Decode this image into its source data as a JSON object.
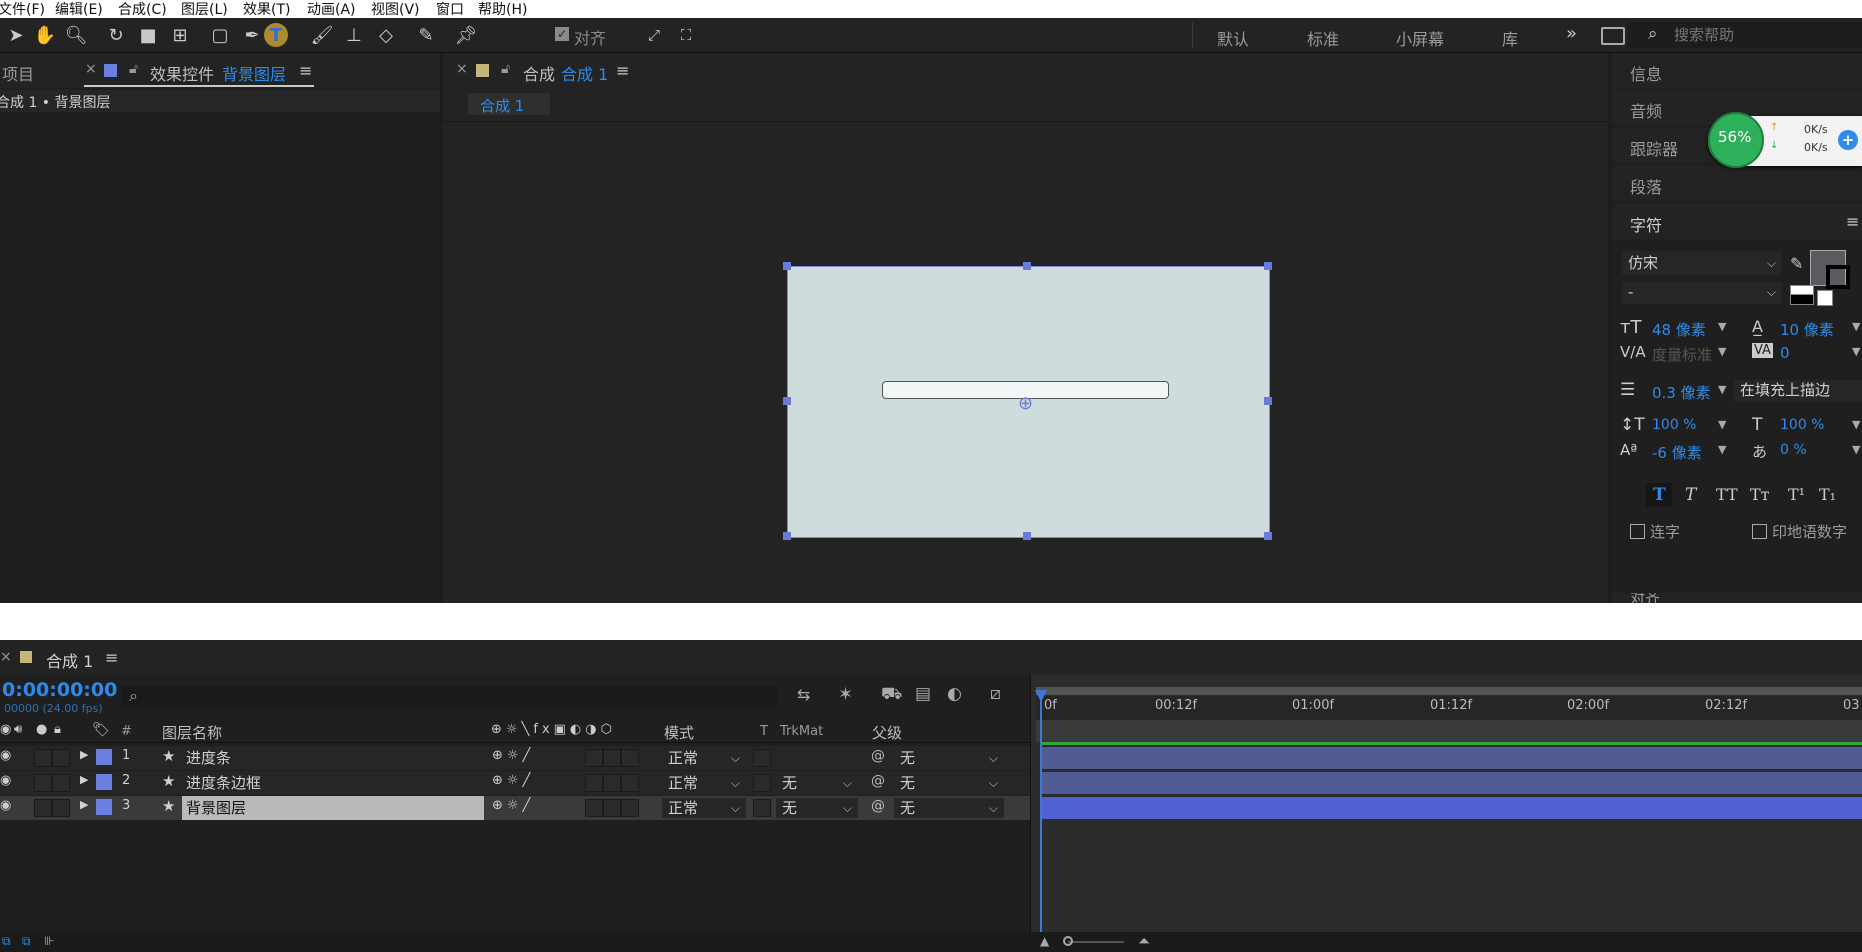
{
  "menu": [
    "文件(F)",
    "编辑(E)",
    "合成(C)",
    "图层(L)",
    "效果(T)",
    "动画(A)",
    "视图(V)",
    "窗口",
    "帮助(H)"
  ],
  "toolbar": {
    "align_label": "对齐",
    "workspaces": [
      "默认",
      "标准",
      "小屏幕",
      "库"
    ],
    "more": "»",
    "search_placeholder": "搜索帮助"
  },
  "left_panel": {
    "project_tab": "项目",
    "close": "×",
    "effects_tab_prefix": "效果控件",
    "effects_tab_layer": "背景图层",
    "menu": "≡",
    "breadcrumb": "合成 1 • 背景图层"
  },
  "comp_panel": {
    "close": "×",
    "tab_prefix": "合成",
    "tab_name": "合成 1",
    "menu": "≡",
    "subtab": "合成 1",
    "canvas_bg": "#cfdcdd"
  },
  "right_panel": {
    "info": "信息",
    "audio": "音频",
    "tracker": "跟踪器",
    "paragraph": "段落",
    "character": "字符",
    "menu": "≡",
    "font": "仿宋",
    "style": "-",
    "size": "48 像素",
    "leading": "10 像素",
    "kerning": "度量标准",
    "tracking": "0",
    "stroke_width": "0.3 像素",
    "stroke_mode": "在填充上描边",
    "vscale": "100 %",
    "hscale": "100 %",
    "baseline": "-6 像素",
    "tsume": "0 %",
    "styles": [
      "T",
      "T",
      "TT",
      "Tт",
      "T¹",
      "T₁"
    ],
    "ligature": "连字",
    "hindi_digits": "印地语数字",
    "cut_text": "对齐"
  },
  "net_widget": {
    "percent": "56%",
    "up": "0K/s",
    "down": "0K/s",
    "plus": "+"
  },
  "timeline": {
    "close": "×",
    "tab": "合成 1",
    "menu": "≡",
    "timecode": "0:00:00:00",
    "frames": "00000 (24.00 fps)",
    "search_icon": "⌕",
    "headers": {
      "num": "#",
      "name": "图层名称",
      "mode": "模式",
      "t": "T",
      "trkmat": "TrkMat",
      "parent": "父级"
    },
    "layers": [
      {
        "num": "1",
        "name": "进度条",
        "mode": "正常",
        "trkmat": "",
        "parent": "无"
      },
      {
        "num": "2",
        "name": "进度条边框",
        "mode": "正常",
        "trkmat": "无",
        "parent": "无"
      },
      {
        "num": "3",
        "name": "背景图层",
        "mode": "正常",
        "trkmat": "无",
        "parent": "无"
      }
    ],
    "ruler": [
      "0f",
      "00:12f",
      "01:00f",
      "01:12f",
      "02:00f",
      "02:12f",
      "03"
    ]
  }
}
